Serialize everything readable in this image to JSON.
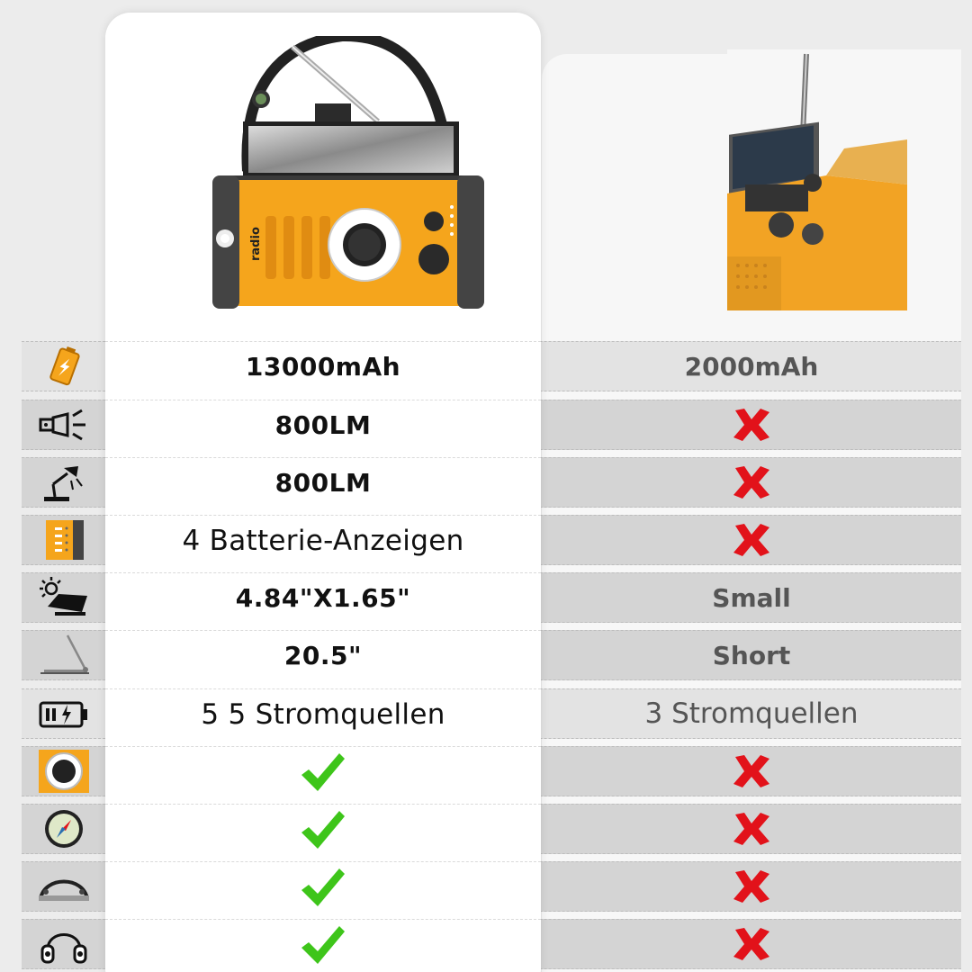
{
  "colors": {
    "accent_orange": "#f5a51c",
    "check_green": "#3ec51a",
    "cross_red": "#e2121a",
    "row_band": "#d4d4d4"
  },
  "products": {
    "left": {
      "name": ""
    },
    "right": {
      "name": ""
    }
  },
  "rows": [
    {
      "icon": "battery-cell-icon",
      "left": "13000mAh",
      "right": "2000mAh",
      "left_style": "bold",
      "right_style": "bold"
    },
    {
      "icon": "flashlight-icon",
      "left": "800LM",
      "right_mark": "cross",
      "left_style": "bold"
    },
    {
      "icon": "reading-lamp-icon",
      "left": "800LM",
      "right_mark": "cross",
      "left_style": "bold"
    },
    {
      "icon": "battery-indicator-icon",
      "left": "4 Batterie-Anzeigen",
      "right_mark": "cross",
      "left_style": "normal"
    },
    {
      "icon": "solar-panel-icon",
      "left": "4.84\"X1.65\"",
      "right": "Small",
      "left_style": "bold",
      "right_style": "bold"
    },
    {
      "icon": "antenna-icon",
      "left": "20.5\"",
      "right": "Short",
      "left_style": "bold",
      "right_style": "bold"
    },
    {
      "icon": "power-source-icon",
      "left": "5 5 Stromquellen",
      "right": "3 Stromquellen",
      "left_style": "normal",
      "right_style": "normal"
    },
    {
      "icon": "tuning-dial-icon",
      "left_mark": "check",
      "right_mark": "cross"
    },
    {
      "icon": "compass-icon",
      "left_mark": "check",
      "right_mark": "cross"
    },
    {
      "icon": "strap-icon",
      "left_mark": "check",
      "right_mark": "cross"
    },
    {
      "icon": "headphones-icon",
      "left_mark": "check",
      "right_mark": "cross"
    }
  ],
  "radio_label": "radio"
}
